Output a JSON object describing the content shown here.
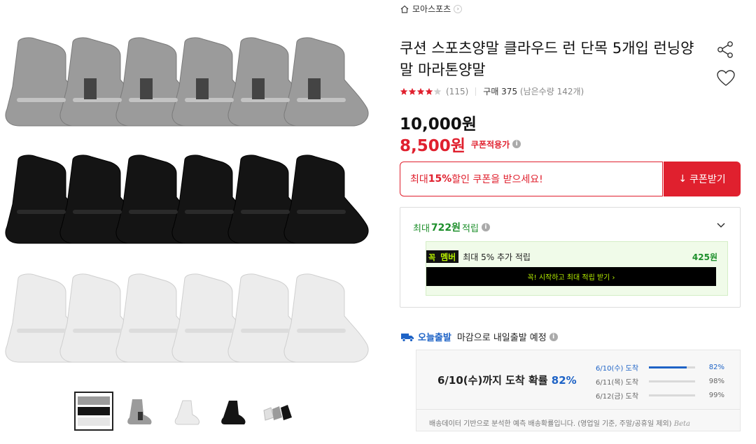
{
  "colors": {
    "accent_red": "#e0202e",
    "point_green": "#1d8f2b",
    "ship_blue": "#1e63c6",
    "member_lime": "#b7f000"
  },
  "gallery": {
    "main_image": "socks-product-image",
    "thumbnails": [
      "thumb-all-colors",
      "thumb-gray",
      "thumb-white",
      "thumb-black",
      "thumb-mixed"
    ]
  },
  "shop": {
    "name": "모아스포츠",
    "home_icon": "home-icon",
    "chevron": "›"
  },
  "product": {
    "title": "쿠션 스포츠양말 클라우드 런 단목 5개입 런닝양말 마라톤양말",
    "rating_stars": 4,
    "review_count": "(115)",
    "purchase": "구매 375",
    "remaining": "(남은수량 142개)"
  },
  "price": {
    "original": "10,000원",
    "sale": "8,500원",
    "coupon_tag": "쿠폰적용가",
    "info": "i"
  },
  "coupon": {
    "prefix": "최대 ",
    "percent": "15%",
    "suffix": " 할인 쿠폰을 받으세요!",
    "button": "쿠폰받기",
    "button_icon": "↓"
  },
  "points": {
    "prefix": "최대",
    "amount": "722원",
    "suffix": "적립",
    "member_badge_k": "꼭",
    "member_badge_m": "멤버",
    "member_text": "최대 5% 추가 적립",
    "member_amount": "425원",
    "member_cta": "꼭! 시작하고 최대 적립 받기 ›"
  },
  "shipping": {
    "today": "오늘출발",
    "desc": "마감으로 내일출발 예정",
    "main_prefix": "6/10(수)까지 도착 확률",
    "main_pct": "82%",
    "rows": [
      {
        "label": "6/10(수) 도착",
        "pct": "82%",
        "value": 0.82
      },
      {
        "label": "6/11(목) 도착",
        "pct": "98%",
        "value": 0.0
      },
      {
        "label": "6/12(금) 도착",
        "pct": "99%",
        "value": 0.0
      }
    ],
    "note": "배송데이터 기반으로 분석한 예측 배송확률입니다. (영업일 기준, 주말/공휴일 제외)",
    "beta": "Beta"
  }
}
